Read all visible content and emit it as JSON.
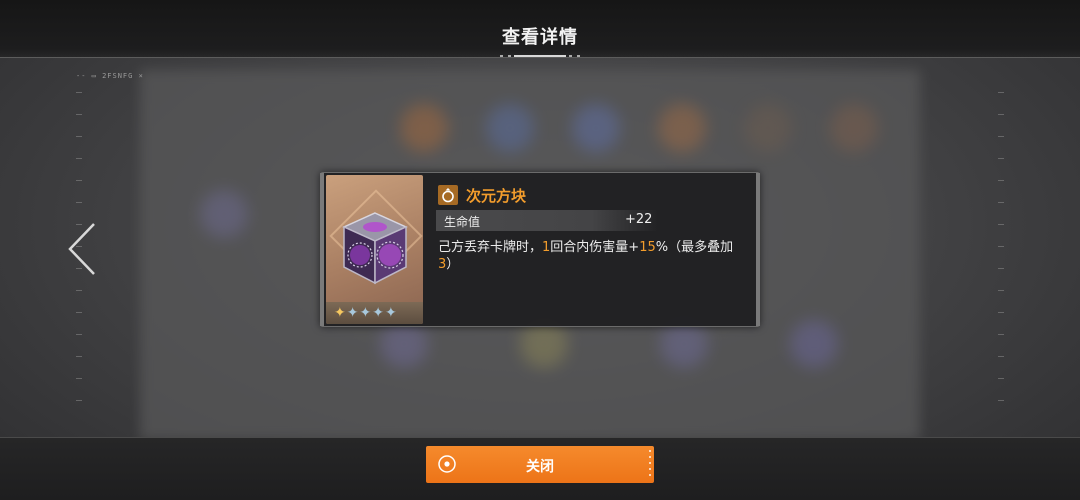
{
  "header": {
    "title": "查看详情"
  },
  "background": {
    "tag_text": "-- ▭ 2FSNFG ×"
  },
  "item": {
    "name": "次元方块",
    "icon": "ring-icon",
    "rarity_stars_filled": 1,
    "rarity_stars_total": 5,
    "stat": {
      "label": "生命值",
      "value": "+22"
    },
    "description": {
      "p1": "己方丢弃卡牌时，",
      "n1": "1",
      "p2": "回合内伤害量+",
      "n2": "15",
      "p3": "%（最多叠加",
      "n3": "3",
      "p4": "）"
    }
  },
  "footer": {
    "close_label": "关闭"
  },
  "colors": {
    "accent": "#f39d2c",
    "button": "#f07d22",
    "card_bg": "#1e1e20"
  }
}
